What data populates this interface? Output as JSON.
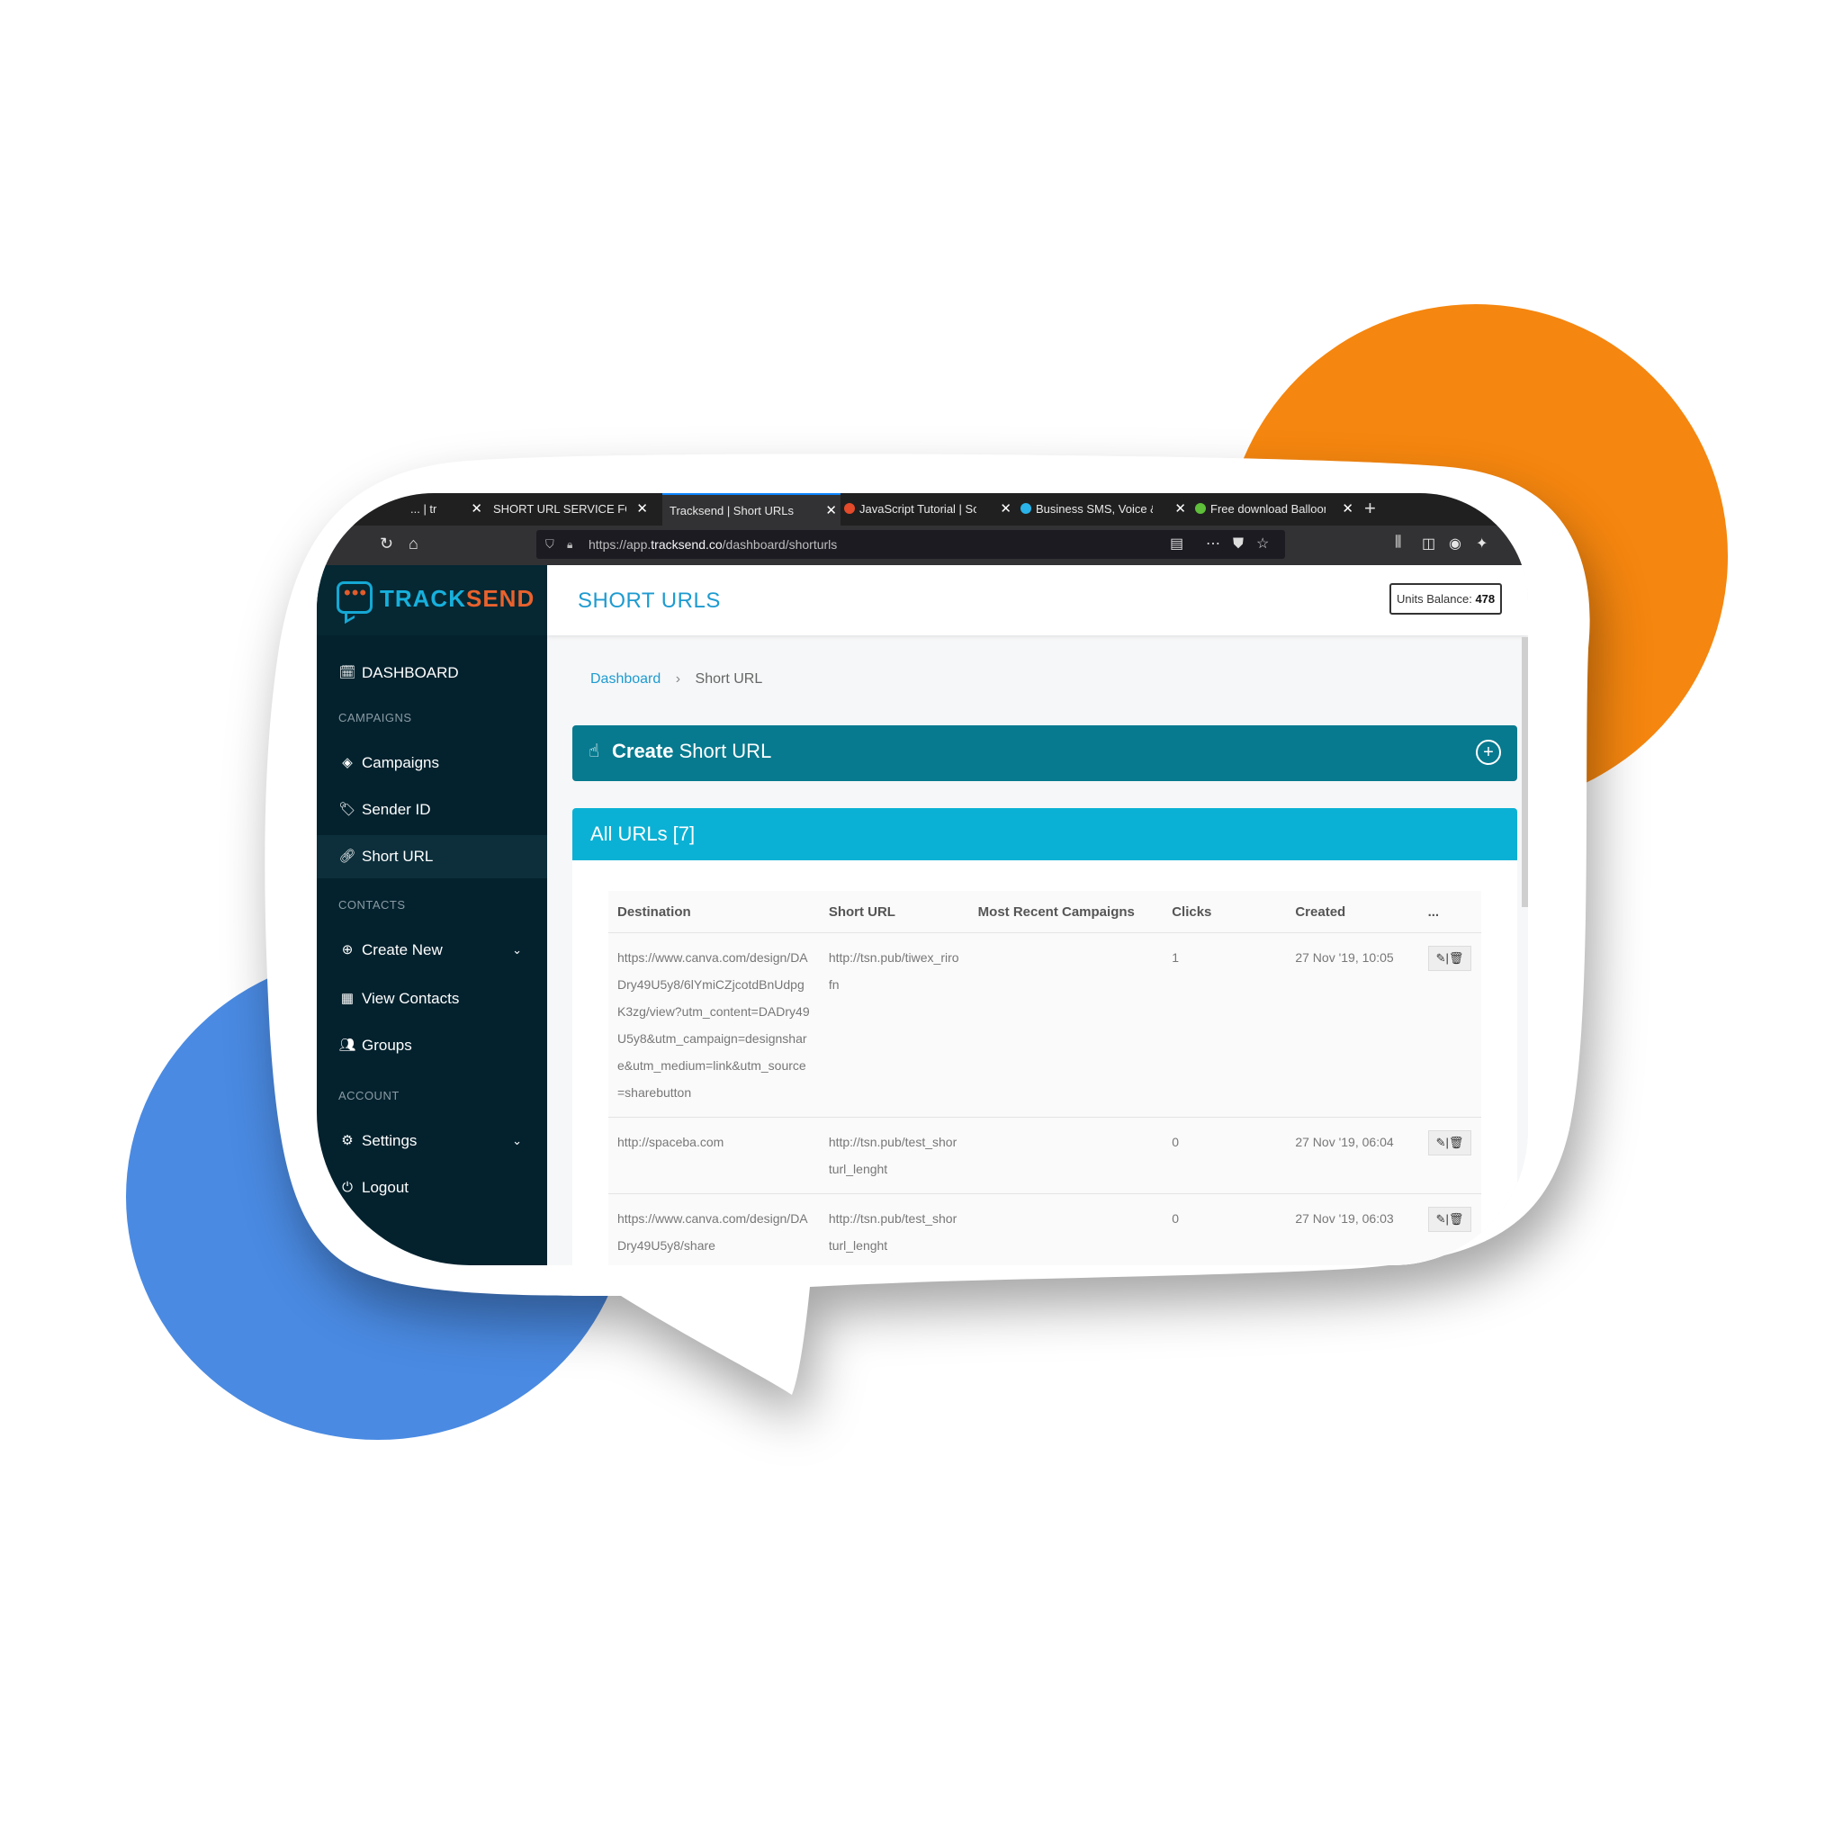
{
  "browser": {
    "tabs": [
      {
        "label": "... | tr",
        "active": false
      },
      {
        "label": "SHORT URL SERVICE FOR YOU",
        "active": false
      },
      {
        "label": "Tracksend | Short URLs",
        "active": true
      },
      {
        "label": "JavaScript Tutorial | Solo",
        "active": false
      },
      {
        "label": "Business SMS, Voice & M",
        "active": false
      },
      {
        "label": "Free download Balloon I",
        "active": false
      }
    ],
    "url": {
      "prefix": "https://app.",
      "host": "tracksend.co",
      "path": "/dashboard/shorturls"
    }
  },
  "brand": {
    "part1": "TRACK",
    "part2": "SEND"
  },
  "sidebar": {
    "dashboard": "DASHBOARD",
    "campaigns_head": "CAMPAIGNS",
    "campaigns": "Campaigns",
    "sender_id": "Sender ID",
    "short_url": "Short URL",
    "contacts_head": "CONTACTS",
    "create_new": "Create New",
    "view_contacts": "View Contacts",
    "groups": "Groups",
    "account_head": "ACCOUNT",
    "settings": "Settings",
    "logout": "Logout"
  },
  "header": {
    "title": "SHORT URLS",
    "units_label": "Units Balance:",
    "units_value": "478"
  },
  "breadcrumb": {
    "home": "Dashboard",
    "current": "Short URL"
  },
  "create_bar": {
    "bold": "Create",
    "rest": " Short URL"
  },
  "all_urls": "All URLs [7]",
  "table": {
    "headers": [
      "Destination",
      "Short URL",
      "Most Recent Campaigns",
      "Clicks",
      "Created",
      "..."
    ],
    "rows": [
      {
        "destination": "https://www.canva.com/design/DADry49U5y8/6lYmiCZjcotdBnUdpgK3zg/view?utm_content=DADry49U5y8&utm_campaign=designshare&utm_medium=link&utm_source=sharebutton",
        "short": "http://tsn.pub/tiwex_rirofn",
        "campaigns": "",
        "clicks": "1",
        "created": "27 Nov '19, 10:05"
      },
      {
        "destination": "http://spaceba.com",
        "short": "http://tsn.pub/test_shorturl_lenght",
        "campaigns": "",
        "clicks": "0",
        "created": "27 Nov '19, 06:04"
      },
      {
        "destination": "https://www.canva.com/design/DADry49U5y8/share",
        "short": "http://tsn.pub/test_shorturl_lenght",
        "campaigns": "",
        "clicks": "0",
        "created": "27 Nov '19, 06:03"
      }
    ]
  },
  "colors": {
    "orange": "#f5860f",
    "blue": "#4a8ae2",
    "sidebar": "#04222e",
    "teal": "#077a8f",
    "cyan": "#0bb1d4"
  },
  "icons": [
    "calendar-icon",
    "layers-icon",
    "tag-icon",
    "link-icon",
    "plus-circle-icon",
    "contact-card-icon",
    "users-icon",
    "gear-icon",
    "logout-icon",
    "cursor-click-icon"
  ]
}
